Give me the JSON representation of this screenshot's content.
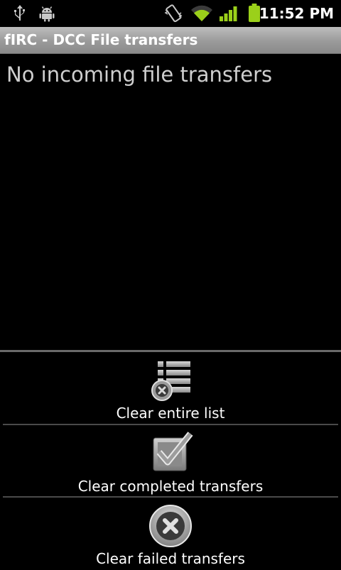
{
  "status_bar": {
    "time": "11:52 PM",
    "icons": [
      "usb-icon",
      "android-debug-icon",
      "vibrate-icon",
      "wifi-icon",
      "signal-icon",
      "battery-icon"
    ]
  },
  "title_bar": {
    "title": "fIRC - DCC File transfers"
  },
  "main": {
    "empty_message": "No incoming file transfers"
  },
  "menu": {
    "items": [
      {
        "label": "Clear entire list",
        "icon": "clear-list-icon"
      },
      {
        "label": "Clear completed transfers",
        "icon": "checkbox-icon"
      },
      {
        "label": "Clear failed transfers",
        "icon": "cancel-circle-icon"
      }
    ]
  },
  "colors": {
    "wifi": "#9bd01a",
    "signal": "#9bd01a",
    "battery": "#9bd01a"
  }
}
